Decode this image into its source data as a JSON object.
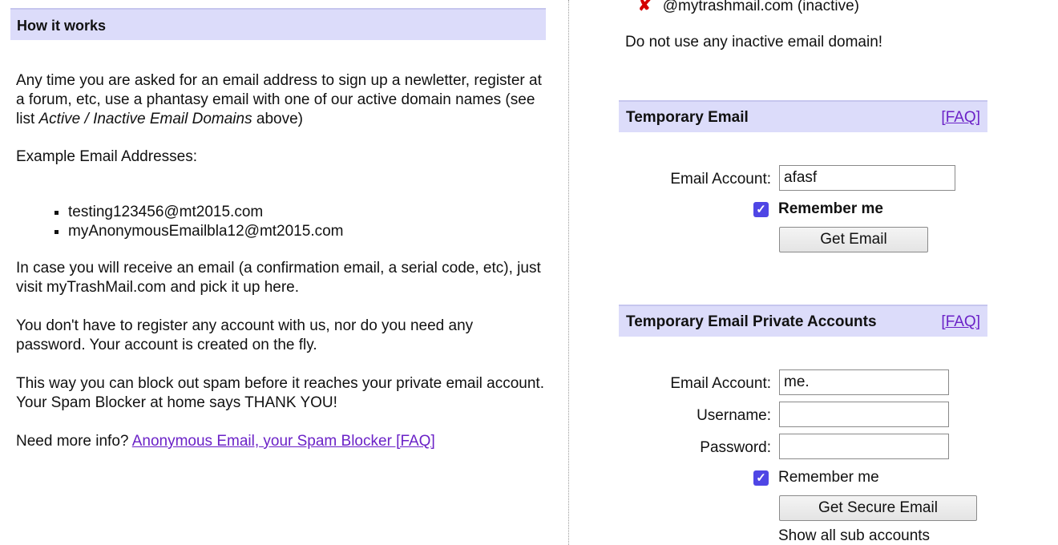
{
  "how_it_works": {
    "title": "How it works",
    "para1_a": "Any time you are asked for an email address to sign up a newletter, register at a forum, etc, use a phantasy email with one of our active domain names (see list ",
    "para1_italic": "Active / Inactive Email Domains",
    "para1_b": " above)",
    "para2": "Example Email Addresses:",
    "examples": [
      "testing123456@mt2015.com",
      "myAnonymousEmailbla12@mt2015.com"
    ],
    "para3": "In case you will receive an email (a confirmation email, a serial code, etc), just visit myTrashMail.com and pick it up here.",
    "para4": "You don't have to register any account with us, nor do you need any password. Your account is created on the fly.",
    "para5": "This way you can block out spam before it  reaches your private email account.  Your Spam Blocker at home says THANK YOU!",
    "para6_prefix": "Need more info? ",
    "para6_link": "Anonymous Email, your Spam Blocker [FAQ]"
  },
  "domains": {
    "inactive_domain": "@mytrashmail.com (inactive)",
    "warning": "Do not use any inactive email domain!"
  },
  "temp_email": {
    "title": "Temporary Email",
    "faq": "[FAQ]",
    "email_label": "Email Account:",
    "email_value": "afasf",
    "remember_label": "Remember me",
    "button": "Get Email"
  },
  "private_accounts": {
    "title": "Temporary Email Private Accounts",
    "faq": "[FAQ]",
    "email_label": "Email Account:",
    "email_value": "me.",
    "username_label": "Username:",
    "username_value": "",
    "password_label": "Password:",
    "password_value": "",
    "remember_label": "Remember me",
    "button": "Get Secure Email",
    "show_all": "Show all sub accounts"
  },
  "colors": {
    "header_bg": "#dcdcfa",
    "link": "#6b22c7",
    "checkbox": "#4f46e5",
    "inactive_x": "#d40000"
  }
}
